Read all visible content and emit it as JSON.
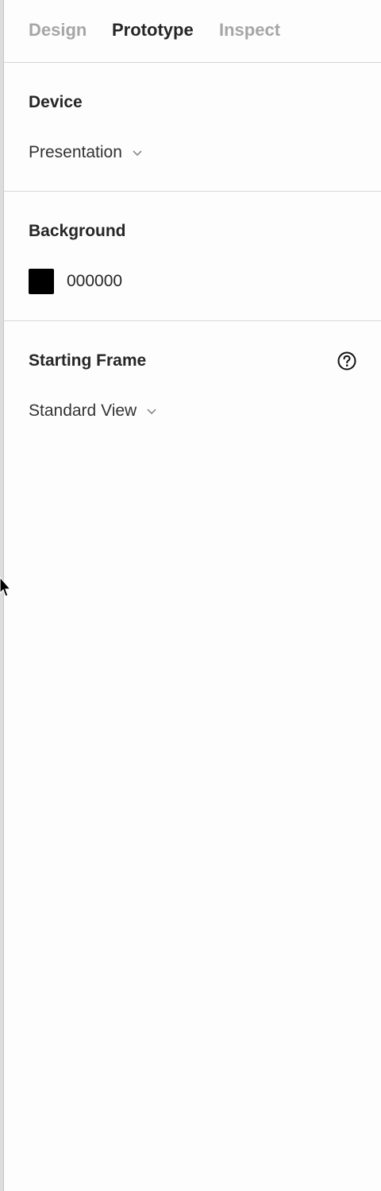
{
  "tabs": [
    {
      "label": "Design",
      "active": false
    },
    {
      "label": "Prototype",
      "active": true
    },
    {
      "label": "Inspect",
      "active": false
    }
  ],
  "device": {
    "title": "Device",
    "selected": "Presentation"
  },
  "background": {
    "title": "Background",
    "color_hex": "000000",
    "swatch_color": "#000000"
  },
  "starting_frame": {
    "title": "Starting Frame",
    "selected": "Standard View",
    "help_icon": "question-circle-icon"
  },
  "colors": {
    "active_tab": "#262626",
    "inactive_tab": "#a6a6a6",
    "divider": "#d6d6d6",
    "background": "#fdfdfd"
  }
}
